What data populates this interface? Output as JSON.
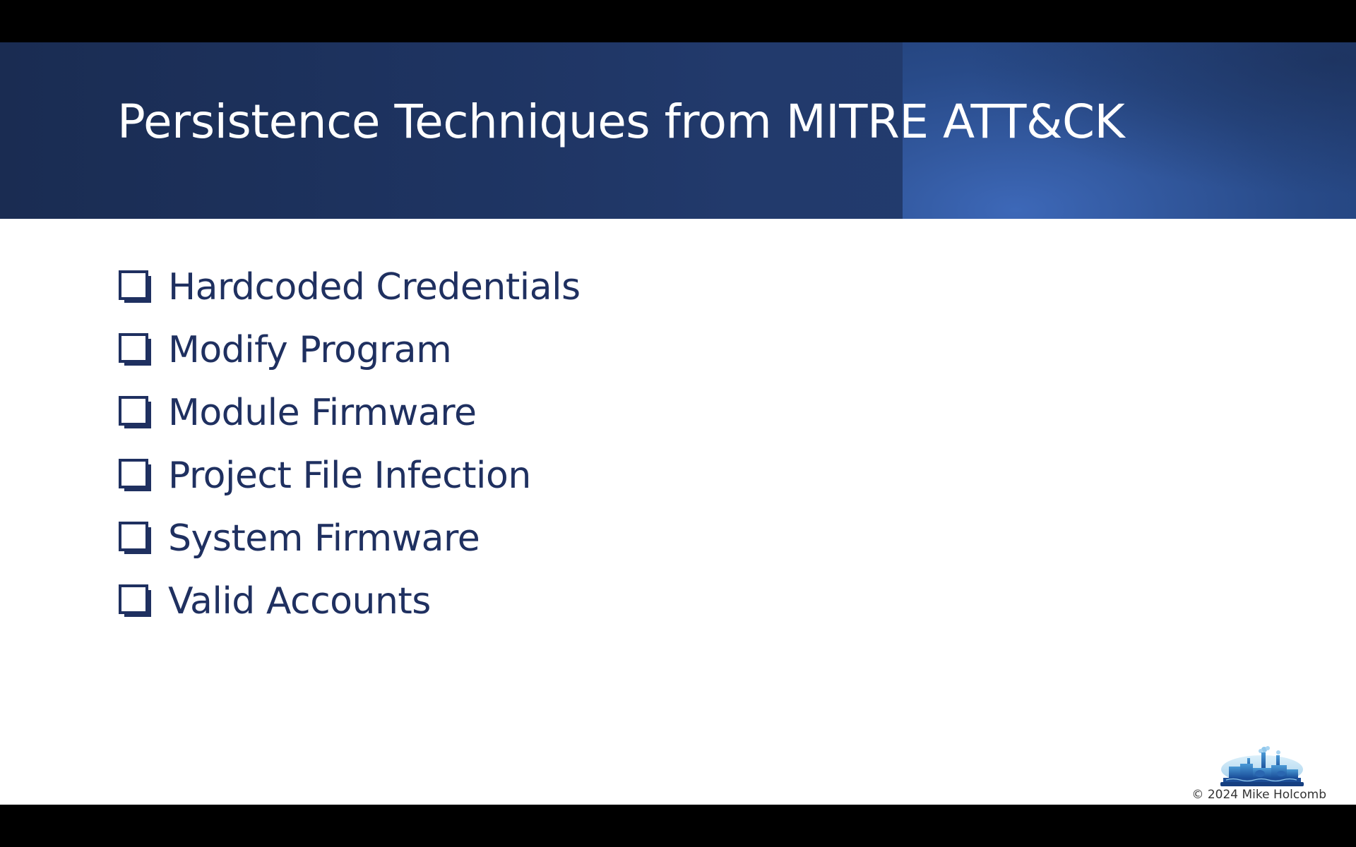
{
  "slide": {
    "title": "Persistence Techniques from MITRE ATT&CK",
    "bullets": [
      {
        "label": "Hardcoded Credentials",
        "icon": "checkbox-icon"
      },
      {
        "label": "Modify Program",
        "icon": "checkbox-icon"
      },
      {
        "label": "Module Firmware",
        "icon": "checkbox-icon"
      },
      {
        "label": "Project File Infection",
        "icon": "checkbox-icon"
      },
      {
        "label": "System Firmware",
        "icon": "checkbox-icon"
      },
      {
        "label": "Valid Accounts",
        "icon": "checkbox-icon"
      }
    ],
    "footer": {
      "copyright": "© 2024 Mike Holcomb",
      "logo_icon": "industrial-plant-logo-icon"
    }
  },
  "colors": {
    "title_band": "#1e3462",
    "title_text": "#ffffff",
    "bullet_text": "#1f3060",
    "background": "#ffffff",
    "letterbox": "#000000"
  }
}
